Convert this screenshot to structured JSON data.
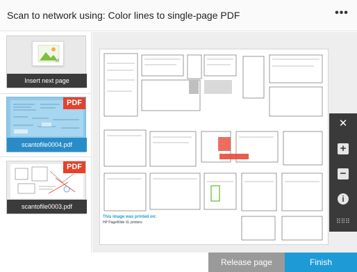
{
  "header": {
    "title": "Scan to network using: Color lines to single-page PDF",
    "more_icon": "more-horizontal-icon",
    "more_glyph": "•••"
  },
  "sidebar": {
    "insert_card": {
      "label": "Insert next page",
      "icon": "image-placeholder-icon"
    },
    "files": [
      {
        "name": "scantofile0004.pdf",
        "badge": "PDF",
        "selected": true
      },
      {
        "name": "scantofile0003.pdf",
        "badge": "PDF",
        "selected": false
      }
    ]
  },
  "preview": {
    "note_title": "This image was printed on:",
    "note_subtitle": "HP PageWide XL printers"
  },
  "zoom_panel": {
    "close_glyph": "✕",
    "zoom_in_glyph": "+",
    "zoom_out_glyph": "−",
    "info_glyph": "i",
    "grip_glyph": "⠿⠿⠿"
  },
  "footer": {
    "release_label": "Release page",
    "finish_label": "Finish"
  },
  "colors": {
    "accent": "#1e9bd7",
    "pdf_badge": "#e8412a",
    "release_button": "#9a9a9a"
  }
}
